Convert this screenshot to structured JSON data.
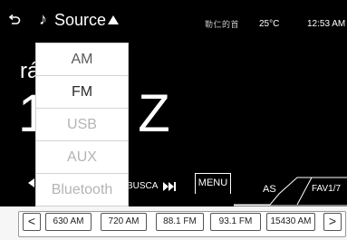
{
  "header": {
    "back_icon": "back-arrow-icon",
    "music_icon": "music-note-icon",
    "source_label": "Source",
    "source_caret_icon": "caret-up-icon",
    "status_icons_text": "勒仁的首",
    "temperature": "25°C",
    "time": "12:53 AM"
  },
  "main": {
    "station_text": "rá",
    "frequency_text": "1",
    "frequency_suffix": "Z"
  },
  "source_menu": {
    "items": [
      {
        "label": "AM",
        "state": "enabled"
      },
      {
        "label": "FM",
        "state": "active"
      },
      {
        "label": "USB",
        "state": "disabled"
      },
      {
        "label": "AUX",
        "state": "disabled"
      },
      {
        "label": "Bluetooth",
        "state": "disabled"
      }
    ]
  },
  "controls": {
    "prev_icon": "skip-previous-icon",
    "busca_label": "BUSCA",
    "next_icon": "skip-next-icon",
    "menu_label": "MENU",
    "as_label": "AS",
    "fav_label": "FAV1/7"
  },
  "presets": {
    "prev_label": "<",
    "next_label": ">",
    "items": [
      "630 AM",
      "720 AM",
      "88.1 FM",
      "93.1 FM",
      "15430 AM"
    ]
  }
}
